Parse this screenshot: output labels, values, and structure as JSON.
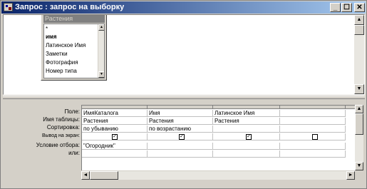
{
  "window": {
    "title": "Запрос : запрос на выборку",
    "minimize": "_",
    "maximize": "☐",
    "close": "✕"
  },
  "table_box": {
    "caption": "Растения",
    "fields": [
      "*",
      "имя",
      "Латинское Имя",
      "Заметки",
      "Фотография",
      "Номер типа"
    ]
  },
  "grid": {
    "row_labels": [
      "Поле:",
      "Имя таблицы:",
      "Сортировка:",
      "Вывод на экран:",
      "Условие отбора:",
      "или:"
    ],
    "columns": [
      {
        "field": "ИмяКаталога",
        "table": "Растения",
        "sort": "по убыванию",
        "show": true,
        "criteria": "\"Огородник\""
      },
      {
        "field": "Имя",
        "table": "Растения",
        "sort": "по возрастанию",
        "show": true,
        "criteria": ""
      },
      {
        "field": "Латинское Имя",
        "table": "Растения",
        "sort": "",
        "show": true,
        "criteria": ""
      },
      {
        "field": "",
        "table": "",
        "sort": "",
        "show": false,
        "criteria": ""
      }
    ]
  },
  "icons": {
    "scroll_up": "▲",
    "scroll_down": "▼",
    "scroll_left": "◄",
    "scroll_right": "►",
    "check": "✓"
  }
}
